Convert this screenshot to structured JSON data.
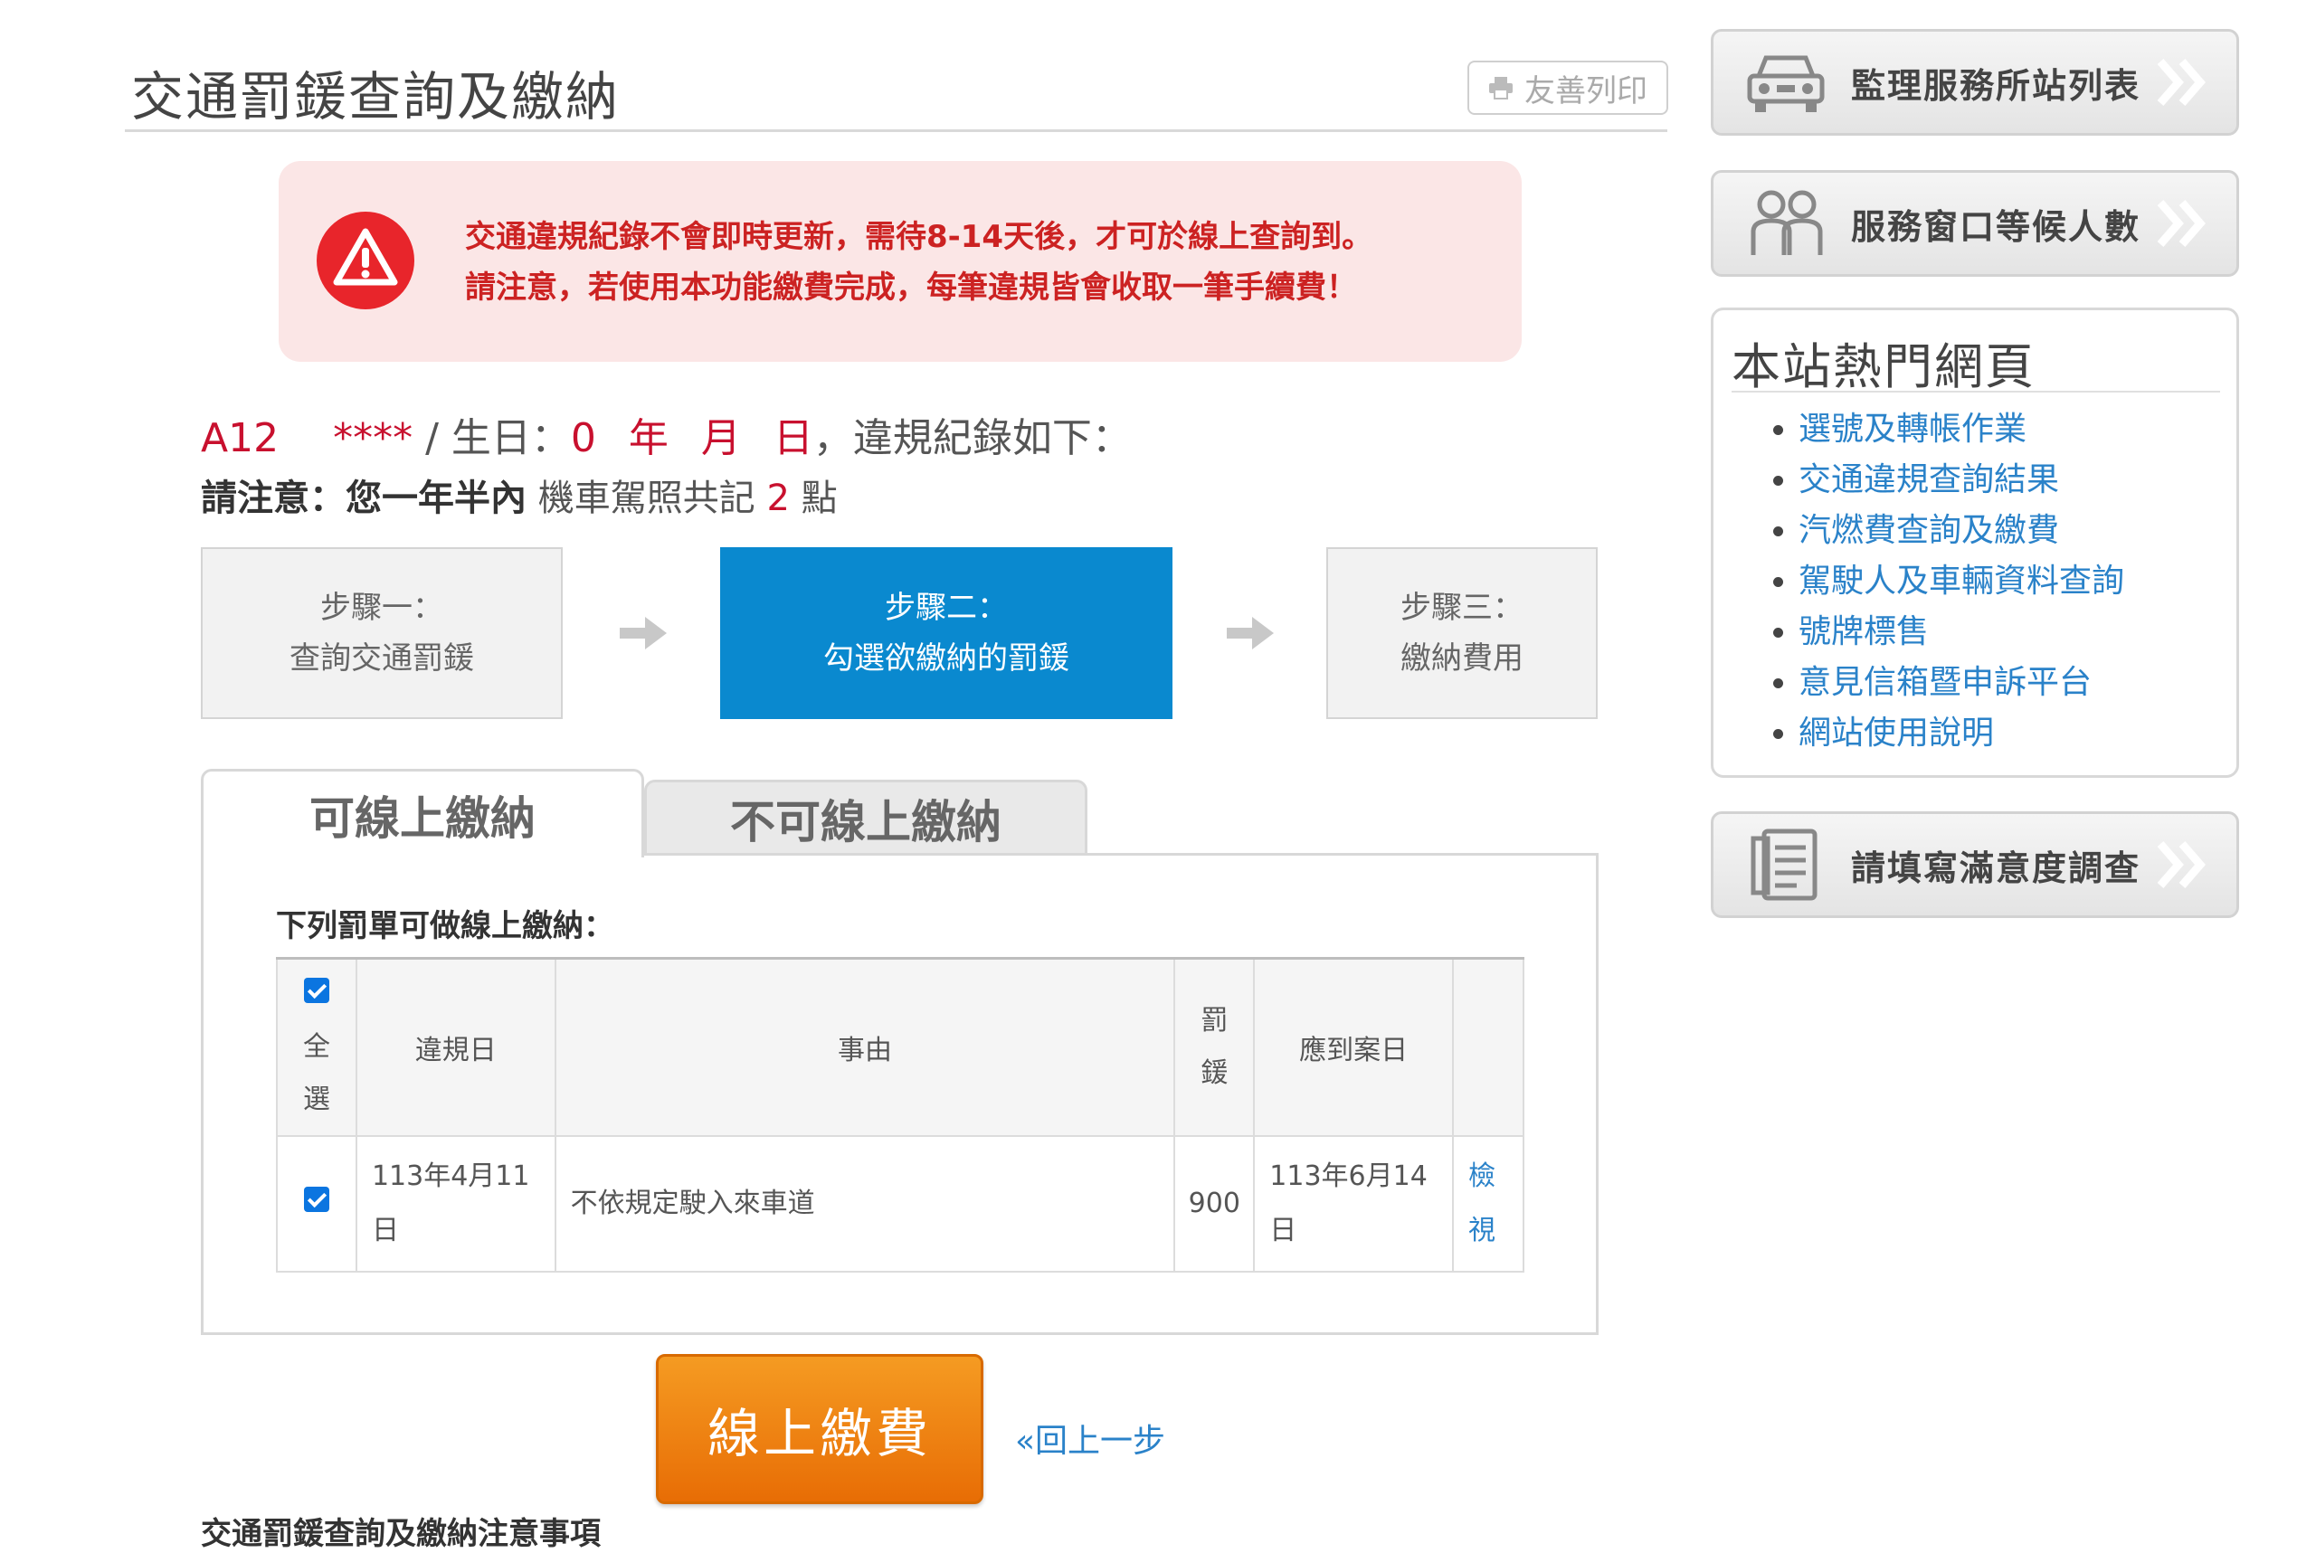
{
  "page": {
    "title": "交通罰鍰查詢及繳納",
    "print_label": "友善列印"
  },
  "alert": {
    "line1": "交通違規紀錄不會即時更新，需待8-14天後，才可於線上查詢到。",
    "line2": "請注意，若使用本功能繳費完成，每筆違規皆會收取一筆手續費！"
  },
  "record": {
    "id_prefix": "A12",
    "id_mask": "****",
    "birthday_label": " / 生日：",
    "birth_year": "0",
    "year_unit": "年",
    "month_unit": "月",
    "day_unit": "日",
    "suffix": "，違規紀錄如下：",
    "notice_label": "請注意：您一年半內",
    "notice_text": " 機車駕照共記 ",
    "points": "2",
    "points_unit": " 點"
  },
  "steps": [
    {
      "title": "步驟一：",
      "label": "查詢交通罰鍰"
    },
    {
      "title": "步驟二：",
      "label": "勾選欲繳納的罰鍰"
    },
    {
      "title": "步驟三：",
      "label": "繳納費用"
    }
  ],
  "tabs": {
    "online": "可線上繳納",
    "offline": "不可線上繳納"
  },
  "panel": {
    "heading": "下列罰單可做線上繳納："
  },
  "table": {
    "headers": {
      "select_all_1": "全",
      "select_all_2": "選",
      "date": "違規日",
      "reason": "事由",
      "fine_1": "罰",
      "fine_2": "鍰",
      "due": "應到案日"
    },
    "rows": [
      {
        "date_1": "113年4月11",
        "date_2": "日",
        "reason": "不依規定駛入來車道",
        "fine": "900",
        "due_1": "113年6月14",
        "due_2": "日",
        "view_1": "檢",
        "view_2": "視",
        "checked": true
      }
    ]
  },
  "actions": {
    "pay": "線上繳費",
    "back": "«回上一步"
  },
  "footer": {
    "title": "交通罰鍰查詢及繳納注意事項"
  },
  "sidebar": {
    "buttons": {
      "stations": "監理服務所站列表",
      "waiting": "服務窗口等候人數",
      "survey": "請填寫滿意度調查"
    },
    "hot_title": "本站熱門網頁",
    "hot_links": [
      "選號及轉帳作業",
      "交通違規查詢結果",
      "汽燃費查詢及繳費",
      "駕駛人及車輛資料查詢",
      "號牌標售",
      "意見信箱暨申訴平台",
      "網站使用說明"
    ]
  },
  "colors": {
    "accent_blue": "#0a89cf",
    "alert_red": "#cc2222",
    "pay_orange": "#f08a1a",
    "link_blue": "#2a82c9"
  }
}
